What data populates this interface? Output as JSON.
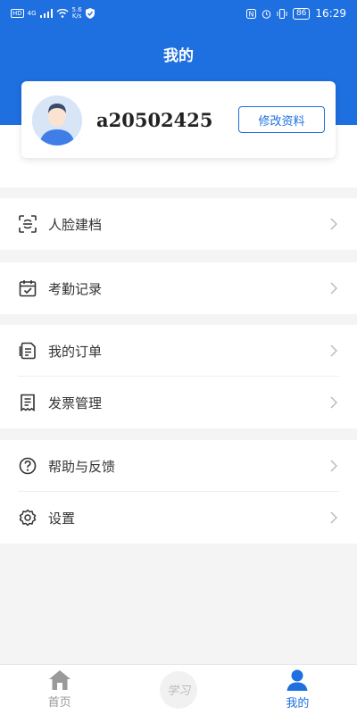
{
  "status_bar": {
    "left_badge": "HD",
    "signal_label": "4G",
    "speed_value": "5.6",
    "speed_unit": "K/s",
    "battery": "86",
    "time": "16:29"
  },
  "header": {
    "title": "我的"
  },
  "profile": {
    "username": "a20502425",
    "edit_label": "修改资料"
  },
  "menu": {
    "face": {
      "label": "人脸建档",
      "icon": "face-scan-icon"
    },
    "attendance": {
      "label": "考勤记录",
      "icon": "calendar-check-icon"
    },
    "orders": {
      "label": "我的订单",
      "icon": "order-icon"
    },
    "invoice": {
      "label": "发票管理",
      "icon": "receipt-icon"
    },
    "help": {
      "label": "帮助与反馈",
      "icon": "help-icon"
    },
    "settings": {
      "label": "设置",
      "icon": "gear-icon"
    }
  },
  "tabbar": {
    "home_label": "首页",
    "study_label": "学习",
    "mine_label": "我的"
  },
  "colors": {
    "accent": "#1e6fe0",
    "background": "#f4f4f4"
  }
}
